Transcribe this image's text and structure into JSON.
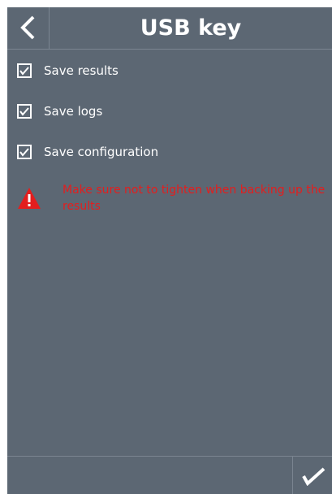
{
  "header": {
    "title": "USB key",
    "back_icon": "chevron-left-icon"
  },
  "options": [
    {
      "label": "Save results",
      "checked": true
    },
    {
      "label": "Save logs",
      "checked": true
    },
    {
      "label": "Save configuration",
      "checked": true
    }
  ],
  "warning": {
    "icon": "warning-triangle-icon",
    "text": "Make sure not to tighten when backing up the results"
  },
  "footer": {
    "confirm_icon": "checkmark-icon"
  },
  "colors": {
    "background": "#5c6773",
    "divider": "#7b8591",
    "text": "#ffffff",
    "warning": "#e31e1e"
  }
}
